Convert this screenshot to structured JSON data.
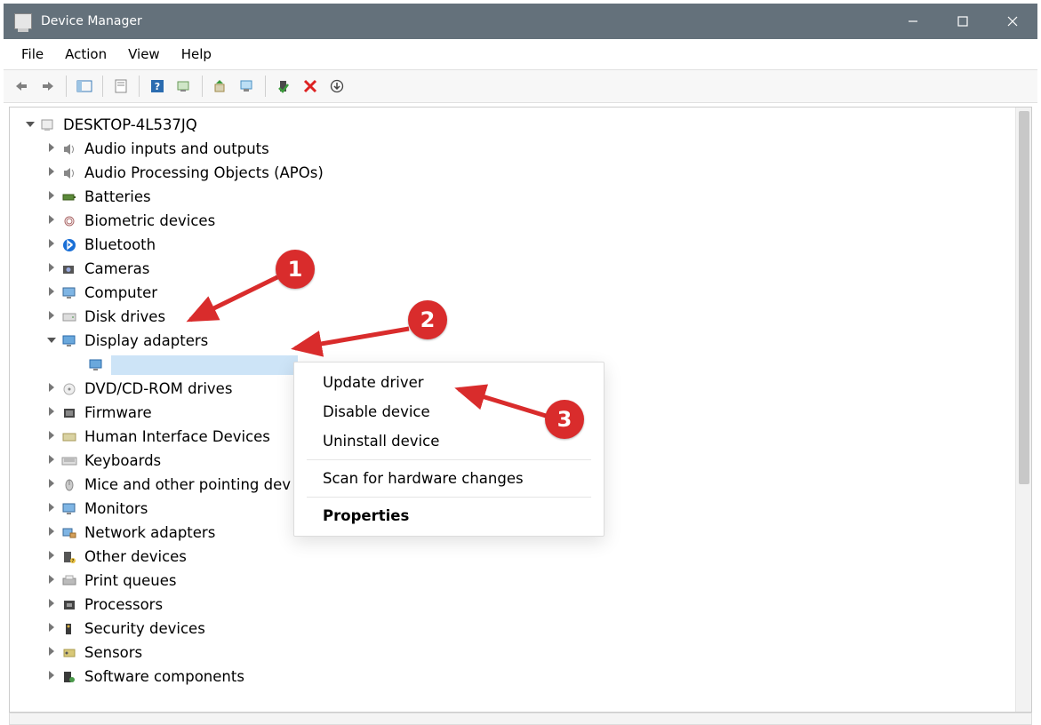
{
  "titlebar": {
    "title": "Device Manager"
  },
  "menubar": {
    "items": [
      "File",
      "Action",
      "View",
      "Help"
    ]
  },
  "tree": {
    "root": "DESKTOP-4L537JQ",
    "categories": [
      {
        "label": "Audio inputs and outputs",
        "icon": "speaker"
      },
      {
        "label": "Audio Processing Objects (APOs)",
        "icon": "speaker"
      },
      {
        "label": "Batteries",
        "icon": "battery"
      },
      {
        "label": "Biometric devices",
        "icon": "fingerprint"
      },
      {
        "label": "Bluetooth",
        "icon": "bluetooth"
      },
      {
        "label": "Cameras",
        "icon": "camera"
      },
      {
        "label": "Computer",
        "icon": "monitor"
      },
      {
        "label": "Disk drives",
        "icon": "disk"
      },
      {
        "label": "Display adapters",
        "icon": "display",
        "expanded": true,
        "children": [
          {
            "label": "",
            "icon": "display",
            "selected": true
          }
        ]
      },
      {
        "label": "DVD/CD-ROM drives",
        "icon": "optical"
      },
      {
        "label": "Firmware",
        "icon": "chip"
      },
      {
        "label": "Human Interface Devices",
        "icon": "hid"
      },
      {
        "label": "Keyboards",
        "icon": "keyboard"
      },
      {
        "label": "Mice and other pointing dev",
        "icon": "mouse",
        "truncated": true
      },
      {
        "label": "Monitors",
        "icon": "monitor"
      },
      {
        "label": "Network adapters",
        "icon": "network"
      },
      {
        "label": "Other devices",
        "icon": "other"
      },
      {
        "label": "Print queues",
        "icon": "printer"
      },
      {
        "label": "Processors",
        "icon": "cpu"
      },
      {
        "label": "Security devices",
        "icon": "security"
      },
      {
        "label": "Sensors",
        "icon": "sensor"
      },
      {
        "label": "Software components",
        "icon": "software"
      }
    ]
  },
  "context_menu": {
    "items": [
      {
        "label": "Update driver",
        "key": "update"
      },
      {
        "label": "Disable device",
        "key": "disable"
      },
      {
        "label": "Uninstall device",
        "key": "uninstall"
      },
      {
        "sep": true
      },
      {
        "label": "Scan for hardware changes",
        "key": "scan"
      },
      {
        "sep": true
      },
      {
        "label": "Properties",
        "key": "properties",
        "bold": true
      }
    ]
  },
  "annotations": {
    "b1": "1",
    "b2": "2",
    "b3": "3"
  }
}
